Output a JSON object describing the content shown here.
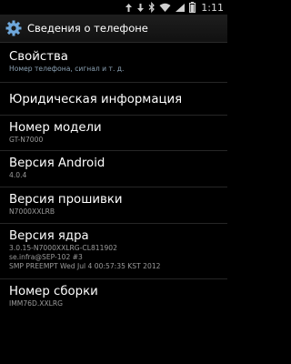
{
  "status_bar": {
    "time": "1:11",
    "icons": [
      "upload-icon",
      "download-icon",
      "bluetooth-icon",
      "wifi-icon",
      "signal-icon",
      "battery-icon"
    ]
  },
  "header": {
    "title": "Сведения о телефоне",
    "icon": "settings-gear-icon"
  },
  "items": [
    {
      "title": "Свойства",
      "sub": "Номер телефона, сигнал и т. д."
    },
    {
      "title": "Юридическая информация"
    },
    {
      "title": "Номер модели",
      "sub": "GT-N7000"
    },
    {
      "title": "Версия Android",
      "sub": "4.0.4"
    },
    {
      "title": "Версия прошивки",
      "sub": "N7000XXLRB"
    },
    {
      "title": "Версия ядра",
      "sub_lines": [
        "3.0.15-N7000XXLRG-CL811902",
        "se.infra@SEP-102 #3",
        "SMP PREEMPT Wed Jul 4 00:57:35 KST 2012"
      ]
    },
    {
      "title": "Номер сборки",
      "sub": "IMM76D.XXLRG"
    }
  ],
  "colors": {
    "background": "#000000",
    "subtitle_blue": "#8aa0b2",
    "subtitle_gray": "#9a9a9a"
  }
}
